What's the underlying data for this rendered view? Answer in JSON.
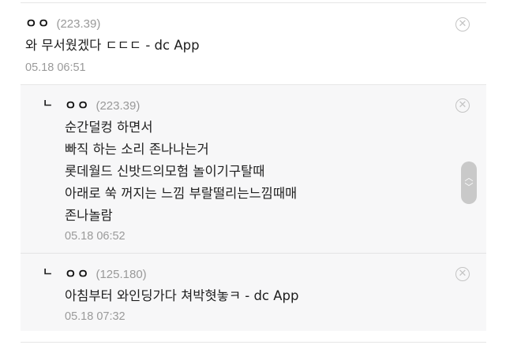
{
  "comments": [
    {
      "nick": "ㅇㅇ",
      "ip": "(223.39)",
      "lines": [
        "와 무서웠겠다 ㄷㄷㄷ - dc App"
      ],
      "date": "05.18 06:51"
    }
  ],
  "replies": [
    {
      "mark": "ㄴ",
      "nick": "ㅇㅇ",
      "ip": "(223.39)",
      "lines": [
        "순간덜컹 하면서",
        "빠직 하는 소리 존나나는거",
        "롯데월드 신밧드의모험 놀이기구탈때",
        "아래로 쑥 꺼지는 느낌 부랄떨리는느낌때매",
        "존나놀람"
      ],
      "date": "05.18 06:52"
    },
    {
      "mark": "ㄴ",
      "nick": "ㅇㅇ",
      "ip": "(125.180)",
      "lines": [
        "아침부터 와인딩가다 쳐박혓놓ㅋ - dc App"
      ],
      "date": "05.18 07:32"
    }
  ],
  "icons": {
    "delete": "close-circle-icon",
    "scroll_up": "chevron-up-icon",
    "scroll_down": "chevron-down-icon"
  },
  "colors": {
    "reply_bg": "#f7f7f8",
    "meta_gray": "#999999",
    "divider": "#e6e6e6"
  }
}
